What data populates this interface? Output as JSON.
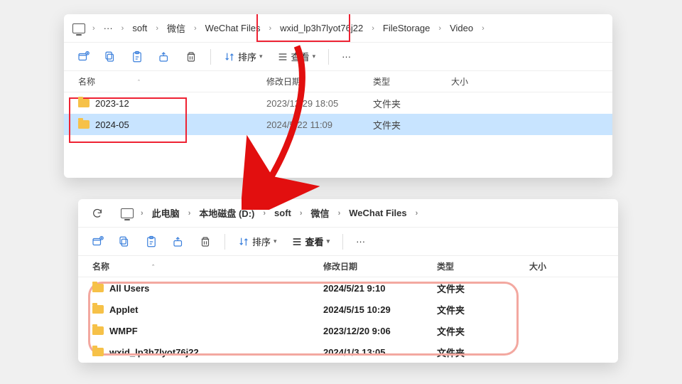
{
  "panel1": {
    "breadcrumb": {
      "ellipsis": "···",
      "items": [
        "soft",
        "微信",
        "WeChat Files",
        "wxid_lp3h7lyot76j22",
        "FileStorage",
        "Video"
      ]
    },
    "toolbar": {
      "sort_label": "排序",
      "view_label": "查看",
      "more": "···"
    },
    "columns": {
      "name": "名称",
      "date": "修改日期",
      "type": "类型",
      "size": "大小"
    },
    "rows": [
      {
        "name": "2023-12",
        "date": "2023/12/29 18:05",
        "type": "文件夹",
        "selected": false
      },
      {
        "name": "2024-05",
        "date": "2024/5/22 11:09",
        "type": "文件夹",
        "selected": true
      }
    ]
  },
  "panel2": {
    "breadcrumb": {
      "items": [
        "此电脑",
        "本地磁盘 (D:)",
        "soft",
        "微信",
        "WeChat Files"
      ]
    },
    "toolbar": {
      "sort_label": "排序",
      "view_label": "查看",
      "more": "···"
    },
    "columns": {
      "name": "名称",
      "date": "修改日期",
      "type": "类型",
      "size": "大小"
    },
    "rows": [
      {
        "name": "All Users",
        "date": "2024/5/21 9:10",
        "type": "文件夹"
      },
      {
        "name": "Applet",
        "date": "2024/5/15 10:29",
        "type": "文件夹"
      },
      {
        "name": "WMPF",
        "date": "2023/12/20 9:06",
        "type": "文件夹"
      },
      {
        "name": "wxid_lp3h7lyot76j22",
        "date": "2024/1/3 13:05",
        "type": "文件夹"
      }
    ]
  }
}
